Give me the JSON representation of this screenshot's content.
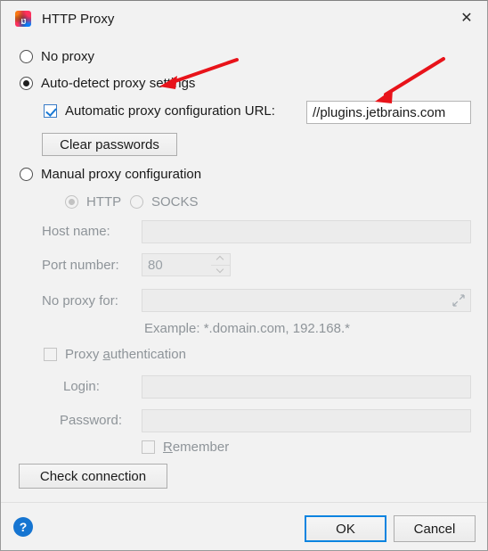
{
  "window": {
    "title": "HTTP Proxy",
    "app_icon": "intellij-idea-icon",
    "close_icon": "✕"
  },
  "proxy_mode": {
    "options": [
      {
        "id": "no-proxy",
        "label": "No proxy",
        "selected": false
      },
      {
        "id": "auto-detect",
        "label": "Auto-detect proxy settings",
        "selected": true
      },
      {
        "id": "manual",
        "label": "Manual proxy configuration",
        "selected": false
      }
    ]
  },
  "auto_detect": {
    "pac_checkbox_label": "Automatic proxy configuration URL:",
    "pac_checkbox_checked": true,
    "pac_url_value": "//plugins.jetbrains.com",
    "clear_passwords_label": "Clear passwords"
  },
  "manual": {
    "protocol": {
      "http_label": "HTTP",
      "http_selected": true,
      "socks_label": "SOCKS",
      "socks_selected": false
    },
    "host_name_label": "Host name:",
    "host_name_value": "",
    "port_number_label": "Port number:",
    "port_number_value": "80",
    "no_proxy_for_label": "No proxy for:",
    "no_proxy_for_value": "",
    "expand_icon": "expand-icon",
    "example_hint": "Example: *.domain.com, 192.168.*",
    "proxy_auth_label": "Proxy authentication",
    "proxy_auth_mnemonic": "a",
    "proxy_auth_checked": false,
    "login_label": "Login:",
    "login_value": "",
    "password_label": "Password:",
    "password_value": "",
    "remember_label": "Remember",
    "remember_mnemonic": "R",
    "remember_checked": false
  },
  "check_connection_label": "Check connection",
  "footer": {
    "help_icon": "?",
    "ok_label": "OK",
    "cancel_label": "Cancel"
  },
  "annotations": {
    "arrow_color": "#e8131a",
    "arrow_1_target": "auto-detect-proxy-settings-radio",
    "arrow_2_target": "pac-url-input"
  }
}
